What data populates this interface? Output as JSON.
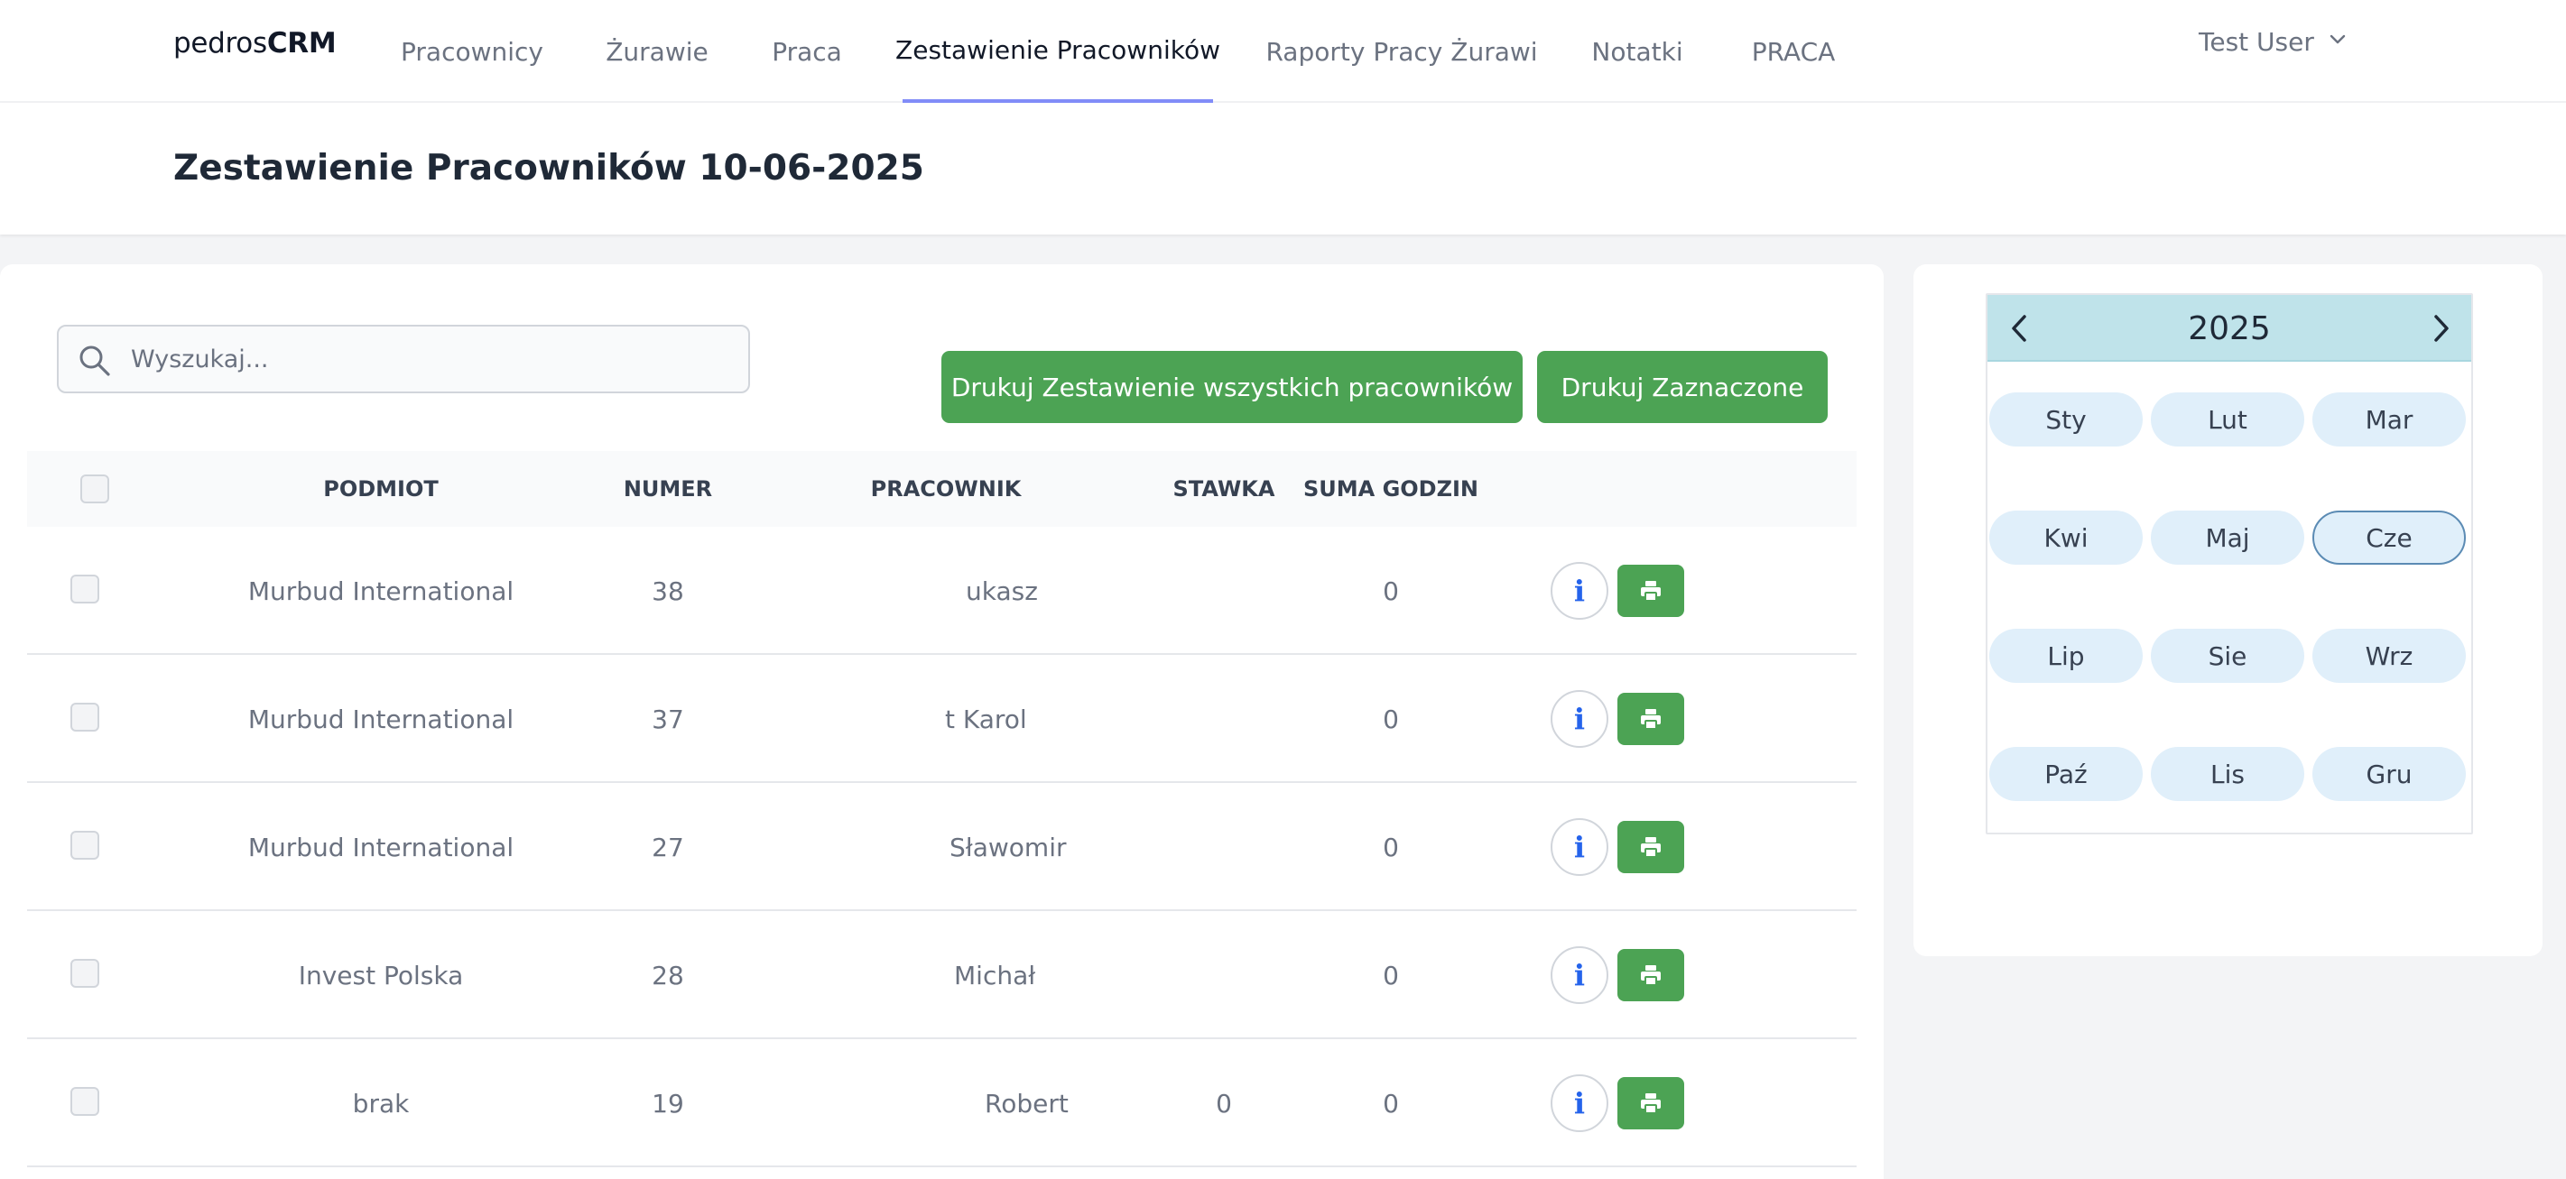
{
  "navbar": {
    "brand_light": "pedros",
    "brand_bold": "CRM",
    "links": [
      "Pracownicy",
      "Żurawie",
      "Praca",
      "Zestawienie Pracowników",
      "Raporty Pracy Żurawi",
      "Notatki",
      "PRACA"
    ],
    "active_link": "Zestawienie Pracowników",
    "user_name": "Test User"
  },
  "page": {
    "title": "Zestawienie Pracowników 10-06-2025"
  },
  "search": {
    "placeholder": "Wyszukaj...",
    "value": ""
  },
  "actions": {
    "print_all_label": "Drukuj Zestawienie wszystkich pracowników",
    "print_selected_label": "Drukuj Zaznaczone"
  },
  "table": {
    "headers": [
      "PODMIOT",
      "NUMER",
      "PRACOWNIK",
      "STAWKA",
      "SUMA GODZIN"
    ],
    "rows": [
      {
        "podmiot": "Murbud International",
        "numer": "38",
        "pracownik": "ukasz",
        "stawka": "",
        "suma_godzin": "0"
      },
      {
        "podmiot": "Murbud International",
        "numer": "37",
        "pracownik": "t Karol",
        "stawka": "",
        "suma_godzin": "0"
      },
      {
        "podmiot": "Murbud International",
        "numer": "27",
        "pracownik": "Sławomir",
        "stawka": "",
        "suma_godzin": "0"
      },
      {
        "podmiot": "Invest Polska",
        "numer": "28",
        "pracownik": "Michał",
        "stawka": "",
        "suma_godzin": "0"
      },
      {
        "podmiot": "brak",
        "numer": "19",
        "pracownik": "Robert",
        "stawka": "0",
        "suma_godzin": "0"
      }
    ],
    "info_icon_glyph": "i"
  },
  "calendar": {
    "year": "2025",
    "months": [
      "Sty",
      "Lut",
      "Mar",
      "Kwi",
      "Maj",
      "Cze",
      "Lip",
      "Sie",
      "Wrz",
      "Paź",
      "Lis",
      "Gru"
    ],
    "selected_month": "Cze"
  },
  "colors": {
    "green": "#4ca354",
    "nav_active_underline": "#818cf8",
    "calendar_header": "#bfe3ea",
    "month_pill": "#e0effa",
    "info_blue": "#2563eb"
  },
  "icons": {
    "search": "search-icon",
    "chevron_down": "chevron-down-icon",
    "info": "info-icon",
    "print": "printer-icon",
    "prev": "chevron-left-icon",
    "next": "chevron-right-icon"
  }
}
